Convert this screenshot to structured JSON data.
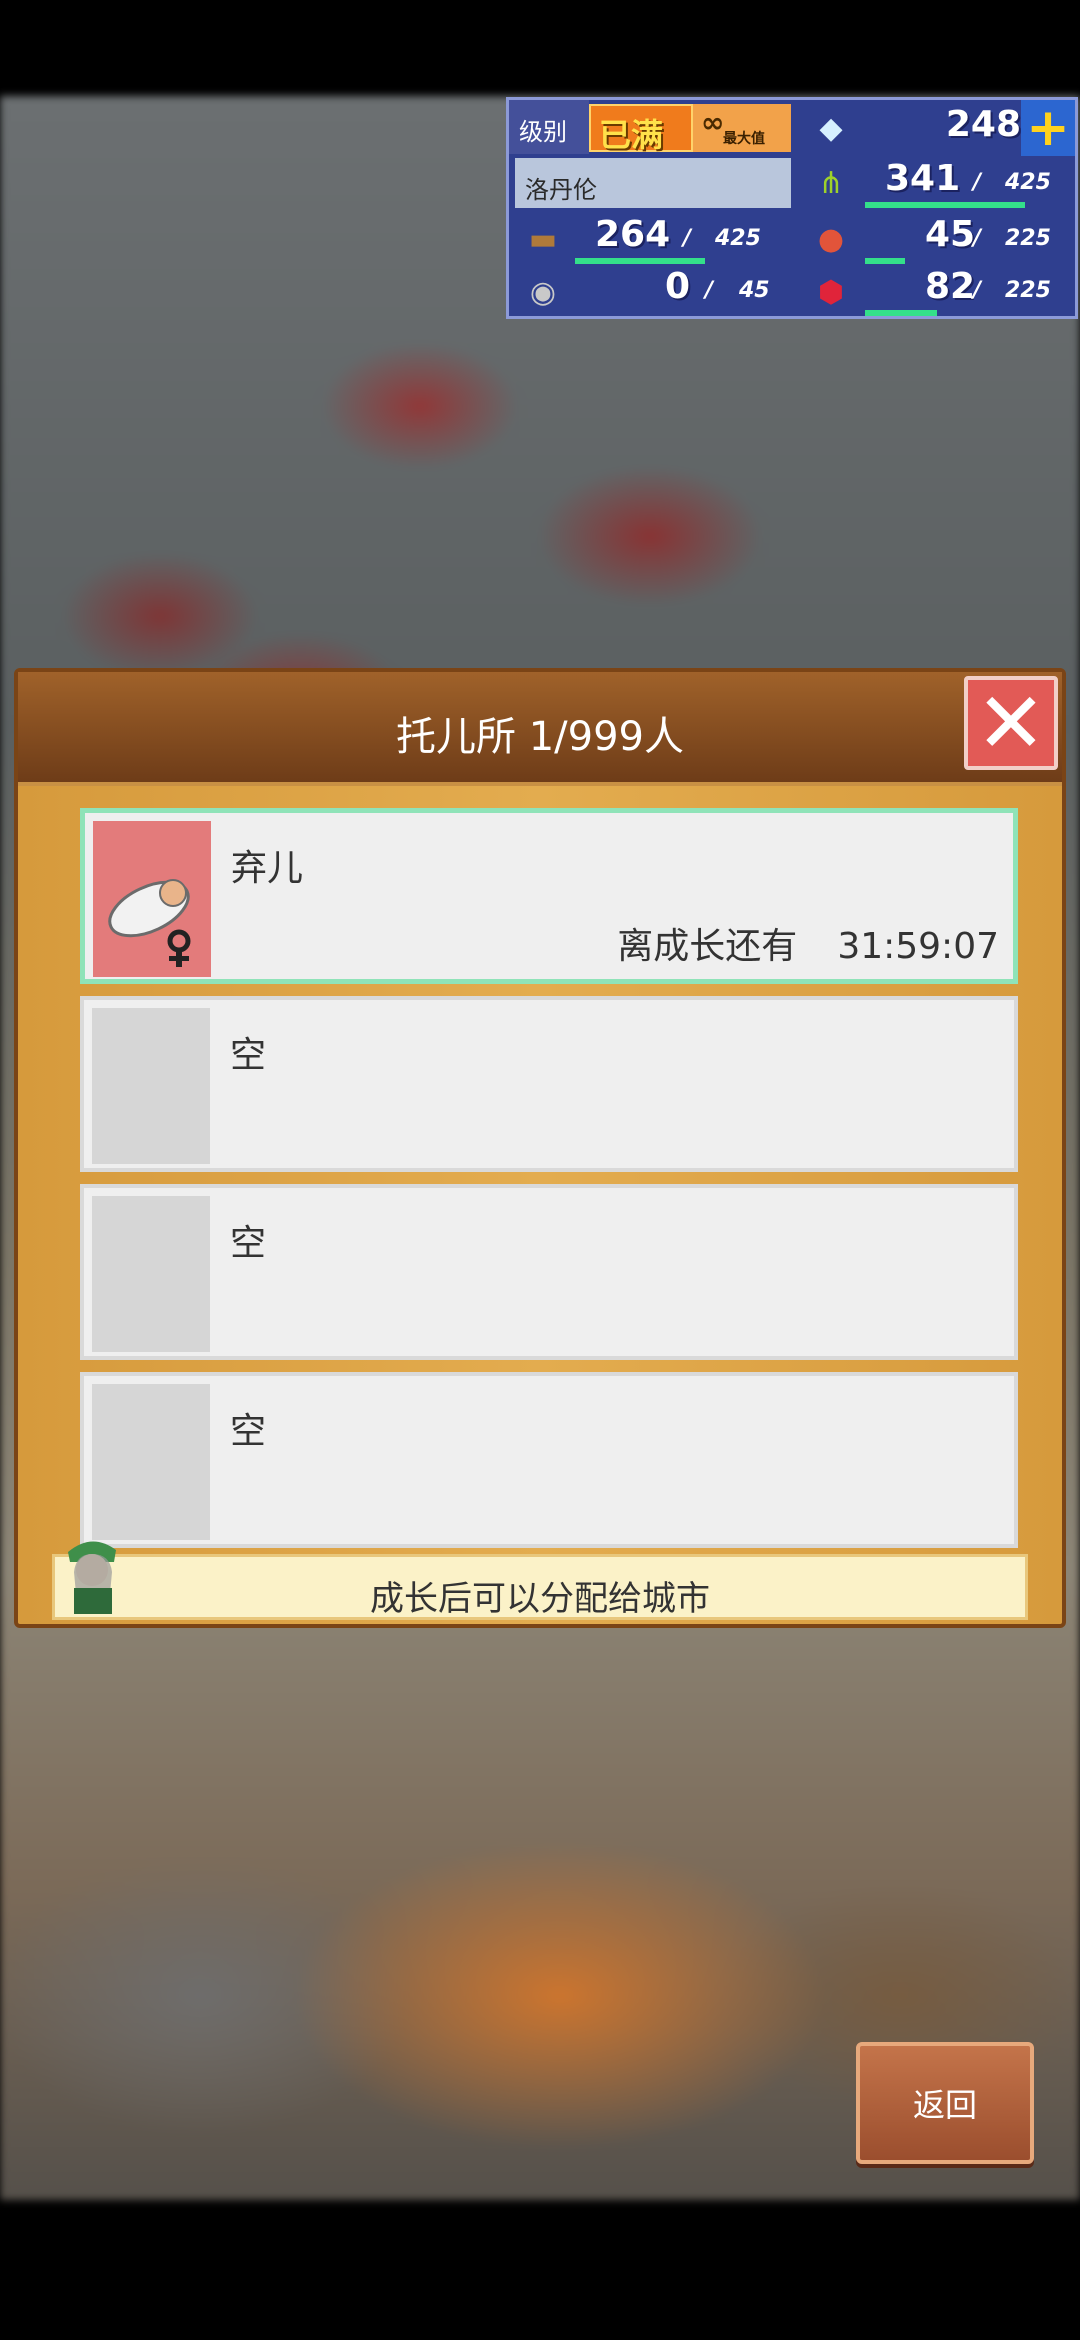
{
  "hud": {
    "level_label": "级别",
    "level_value": "已满",
    "level_badge": "最大值",
    "gems": "248",
    "city_name": "洛丹伦",
    "resources": {
      "food": {
        "value": "341",
        "max": "425",
        "fill": 0.8
      },
      "wood": {
        "value": "264",
        "max": "425",
        "fill": 0.62
      },
      "meat": {
        "value": "45",
        "max": "225",
        "fill": 0.2
      },
      "stone": {
        "value": "0",
        "max": "45",
        "fill": 0.0
      },
      "ruby": {
        "value": "82",
        "max": "225",
        "fill": 0.36
      }
    },
    "sep": "/",
    "plus": "+"
  },
  "dialog": {
    "title": "托儿所 1/999人",
    "slots": [
      {
        "name": "弃儿",
        "sub_label": "离成长还有",
        "time": "31:59:07"
      },
      {
        "name": "空"
      },
      {
        "name": "空"
      },
      {
        "name": "空"
      }
    ],
    "hint": "成长后可以分配给城市"
  },
  "back_button": "返回",
  "colors": {
    "hud_bg": "#2f3f8f",
    "bar_fill": "#34e08a",
    "close_red": "#e25a56",
    "active_border": "#8fe3b8"
  }
}
